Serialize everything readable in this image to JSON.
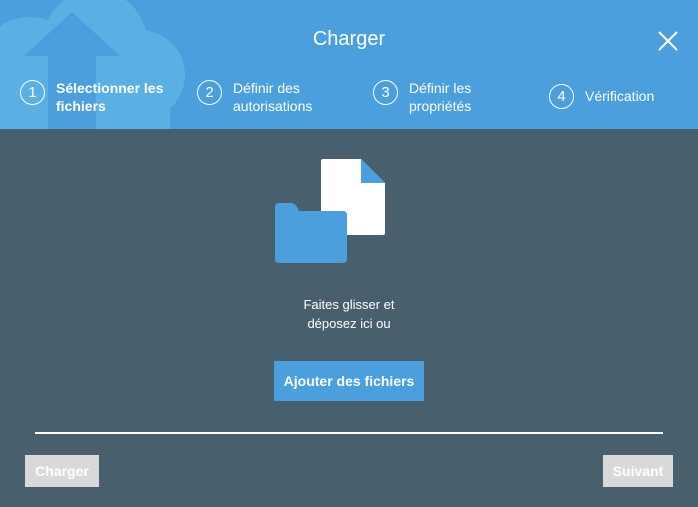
{
  "dialog": {
    "title": "Charger",
    "close_icon": "close-icon"
  },
  "steps": [
    {
      "number": "1",
      "label": "Sélectionner les fichiers",
      "active": true
    },
    {
      "number": "2",
      "label": "Définir des autorisations",
      "active": false
    },
    {
      "number": "3",
      "label": "Définir les propriétés",
      "active": false
    },
    {
      "number": "4",
      "label": "Vérification",
      "active": false
    }
  ],
  "dropzone": {
    "icon": "folder-file-icon",
    "text_line1": "Faites glisser et",
    "text_line2": "déposez ici ou",
    "add_button": "Ajouter des fichiers"
  },
  "footer": {
    "upload_button": "Charger",
    "next_button": "Suivant"
  },
  "colors": {
    "header": "#4a9fdc",
    "body": "#485f6e",
    "accent": "#4a9fdc",
    "disabled_button": "#d9d9d9"
  }
}
